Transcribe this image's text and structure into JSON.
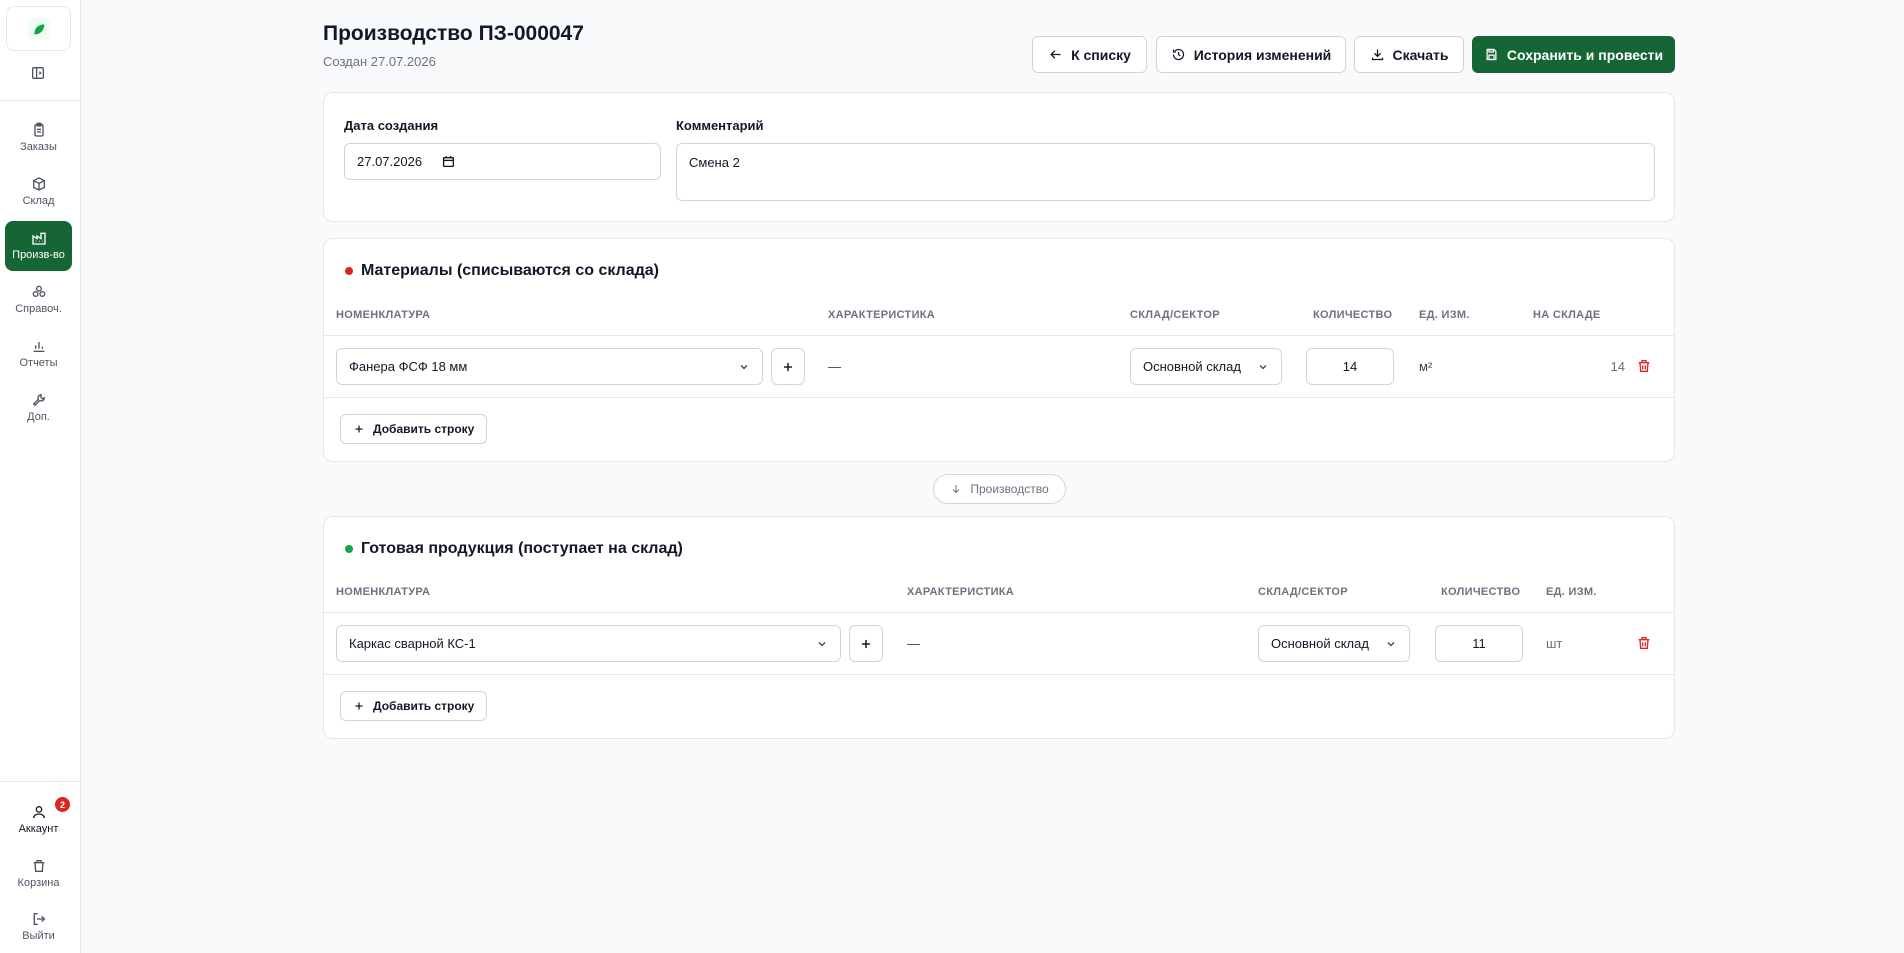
{
  "sidebar": {
    "items": [
      {
        "label": "Заказы",
        "icon": "clipboard-icon"
      },
      {
        "label": "Склад",
        "icon": "package-icon"
      },
      {
        "label": "Произв-во",
        "icon": "factory-icon"
      },
      {
        "label": "Справоч.",
        "icon": "boxes-icon"
      },
      {
        "label": "Отчеты",
        "icon": "bar-chart-icon"
      },
      {
        "label": "Доп.",
        "icon": "wrench-icon"
      }
    ],
    "bottom": [
      {
        "label": "Аккаунт",
        "icon": "user-icon",
        "badge": "2"
      },
      {
        "label": "Корзина",
        "icon": "trash-icon"
      },
      {
        "label": "Выйти",
        "icon": "logout-icon"
      }
    ]
  },
  "header": {
    "title": "Производство ПЗ-000047",
    "subtitle": "Создан 27.07.2026",
    "back_label": "К списку",
    "history_label": "История изменений",
    "download_label": "Скачать",
    "save_label": "Сохранить и провести"
  },
  "form": {
    "date_label": "Дата создания",
    "date_value": "27.07.2026",
    "comment_label": "Комментарий",
    "comment_value": "Смена 2"
  },
  "materials": {
    "title": "Материалы (списываются со склада)",
    "columns": [
      "НОМЕНКЛАТУРА",
      "ХАРАКТЕРИСТИКА",
      "СКЛАД/СЕКТОР",
      "КОЛИЧЕСТВО",
      "ЕД. ИЗМ.",
      "НА СКЛАДЕ"
    ],
    "rows": [
      {
        "item": "Фанера ФСФ 18 мм",
        "characteristic": "—",
        "warehouse": "Основной склад",
        "quantity": "14",
        "unit": "м²",
        "in_stock": "14"
      }
    ],
    "add_label": "Добавить строку"
  },
  "production_label": "Производство",
  "products": {
    "title": "Готовая продукция (поступает на склад)",
    "columns": [
      "НОМЕНКЛАТУРА",
      "ХАРАКТЕРИСТИКА",
      "СКЛАД/СЕКТОР",
      "КОЛИЧЕСТВО",
      "ЕД. ИЗМ."
    ],
    "rows": [
      {
        "item": "Каркас сварной КС-1",
        "characteristic": "—",
        "warehouse": "Основной склад",
        "quantity": "11",
        "unit": "шт"
      }
    ],
    "add_label": "Добавить строку"
  },
  "colors": {
    "accent": "#166534",
    "danger": "#dc2626",
    "materials_dot": "#dc2626",
    "products_dot": "#16a34a"
  }
}
